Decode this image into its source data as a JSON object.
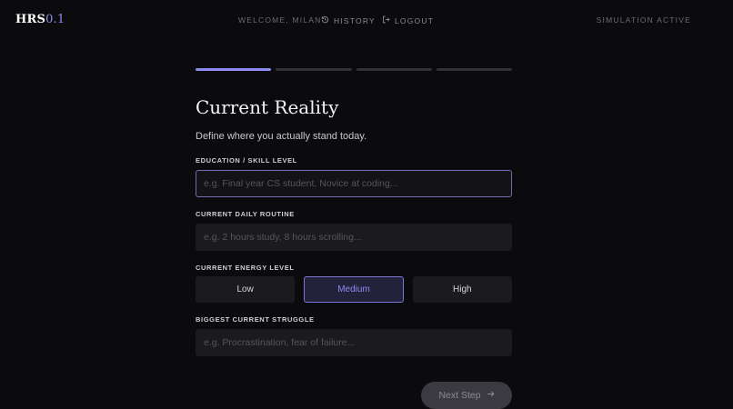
{
  "header": {
    "logo": "HRS",
    "version": "0.1",
    "welcome": "WELCOME, MILAN",
    "history": "HISTORY",
    "logout": "LOGOUT",
    "status": "SIMULATION ACTIVE"
  },
  "progress": {
    "steps": 4,
    "current": 1
  },
  "form": {
    "title": "Current Reality",
    "subtitle": "Define where you actually stand today.",
    "education": {
      "label": "EDUCATION / SKILL LEVEL",
      "placeholder": "e.g. Final year CS student, Novice at coding...",
      "value": ""
    },
    "routine": {
      "label": "CURRENT DAILY ROUTINE",
      "placeholder": "e.g. 2 hours study, 8 hours scrolling...",
      "value": ""
    },
    "energy": {
      "label": "CURRENT ENERGY LEVEL",
      "options": [
        "Low",
        "Medium",
        "High"
      ],
      "selected": "Medium"
    },
    "struggle": {
      "label": "BIGGEST CURRENT STRUGGLE",
      "placeholder": "e.g. Procrastination, fear of failure...",
      "value": ""
    },
    "next_label": "Next Step"
  },
  "colors": {
    "accent": "#8f8bf0",
    "background": "#0b0b0d",
    "field": "#1b1b1e"
  }
}
